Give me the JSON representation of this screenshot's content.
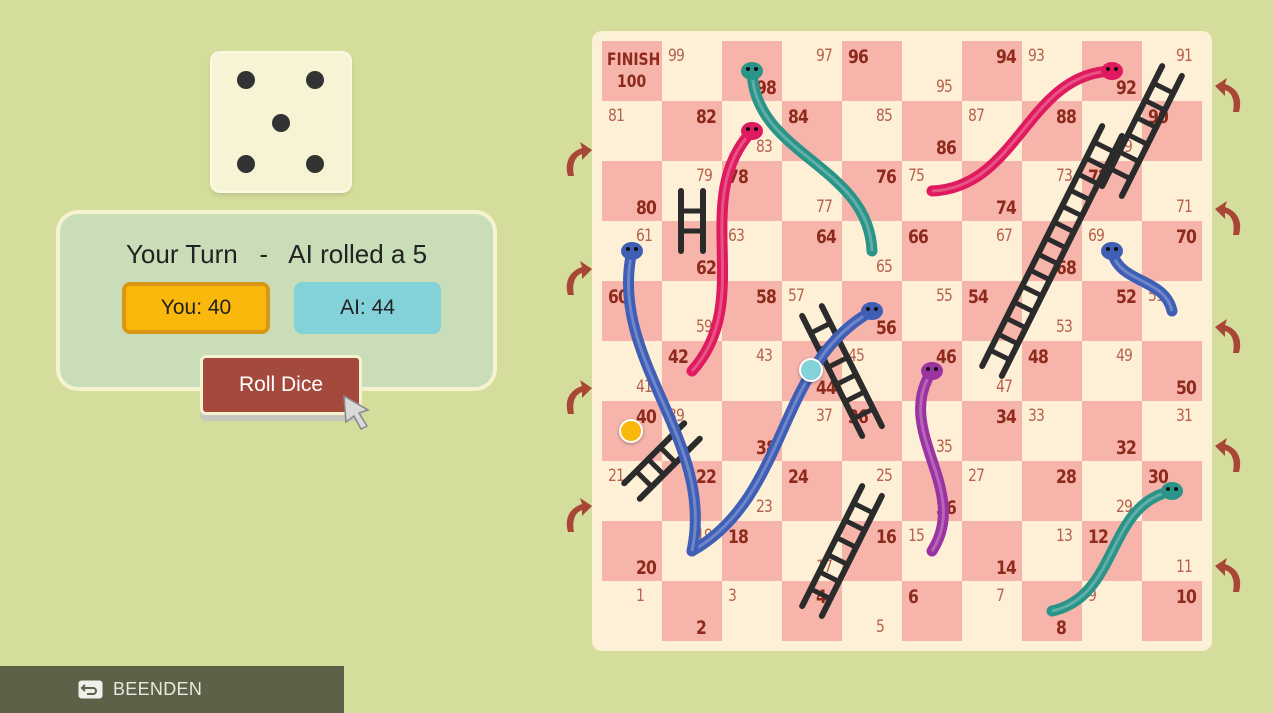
{
  "die": {
    "value": 5
  },
  "status": {
    "turn_text": "Your Turn   -   AI rolled a 5"
  },
  "scores": {
    "you_label": "You: 40",
    "ai_label": "AI: 44"
  },
  "roll_button": {
    "label": "Roll Dice"
  },
  "quit_button": {
    "label": "BEENDEN",
    "icon": "back-arrow-icon"
  },
  "board": {
    "finish_label_1": "FINISH",
    "finish_label_2": "100",
    "cells": [
      1,
      2,
      3,
      4,
      5,
      6,
      7,
      8,
      9,
      10,
      11,
      12,
      13,
      14,
      15,
      16,
      17,
      18,
      19,
      20,
      21,
      22,
      23,
      24,
      25,
      26,
      27,
      28,
      29,
      30,
      31,
      32,
      33,
      34,
      35,
      36,
      37,
      38,
      39,
      40,
      41,
      42,
      43,
      44,
      45,
      46,
      47,
      48,
      49,
      50,
      51,
      52,
      53,
      54,
      55,
      56,
      57,
      58,
      59,
      60,
      61,
      62,
      63,
      64,
      65,
      66,
      67,
      68,
      69,
      70,
      71,
      72,
      73,
      74,
      75,
      76,
      77,
      78,
      79,
      80,
      81,
      82,
      83,
      84,
      85,
      86,
      87,
      88,
      89,
      90,
      91,
      92,
      93,
      94,
      95,
      96,
      97,
      98,
      99
    ],
    "players": [
      {
        "name": "You",
        "position": 40,
        "color": "#fbb80c"
      },
      {
        "name": "AI",
        "position": 44,
        "color": "#84d2d9"
      }
    ],
    "ladders": [
      [
        4,
        25
      ],
      [
        21,
        39
      ],
      [
        36,
        57
      ],
      [
        47,
        89
      ],
      [
        62,
        79
      ],
      [
        72,
        91
      ]
    ],
    "snakes": [
      {
        "from": 56,
        "to": 19,
        "color": "#3f5fb6"
      },
      {
        "from": 61,
        "to": 19,
        "color": "#3f5fb6"
      },
      {
        "from": 83,
        "to": 42,
        "color": "#e01a5e"
      },
      {
        "from": 98,
        "to": 65,
        "color": "#2b9489"
      },
      {
        "from": 92,
        "to": 75,
        "color": "#e01a5e"
      },
      {
        "from": 69,
        "to": 51,
        "color": "#3f5fb6"
      },
      {
        "from": 46,
        "to": 15,
        "color": "#9b33a3"
      },
      {
        "from": 30,
        "to": 8,
        "color": "#2b9489"
      }
    ],
    "colors": {
      "dark": "#f6b4ab",
      "light": "#fef0d6",
      "arrow": "#a84736"
    }
  }
}
